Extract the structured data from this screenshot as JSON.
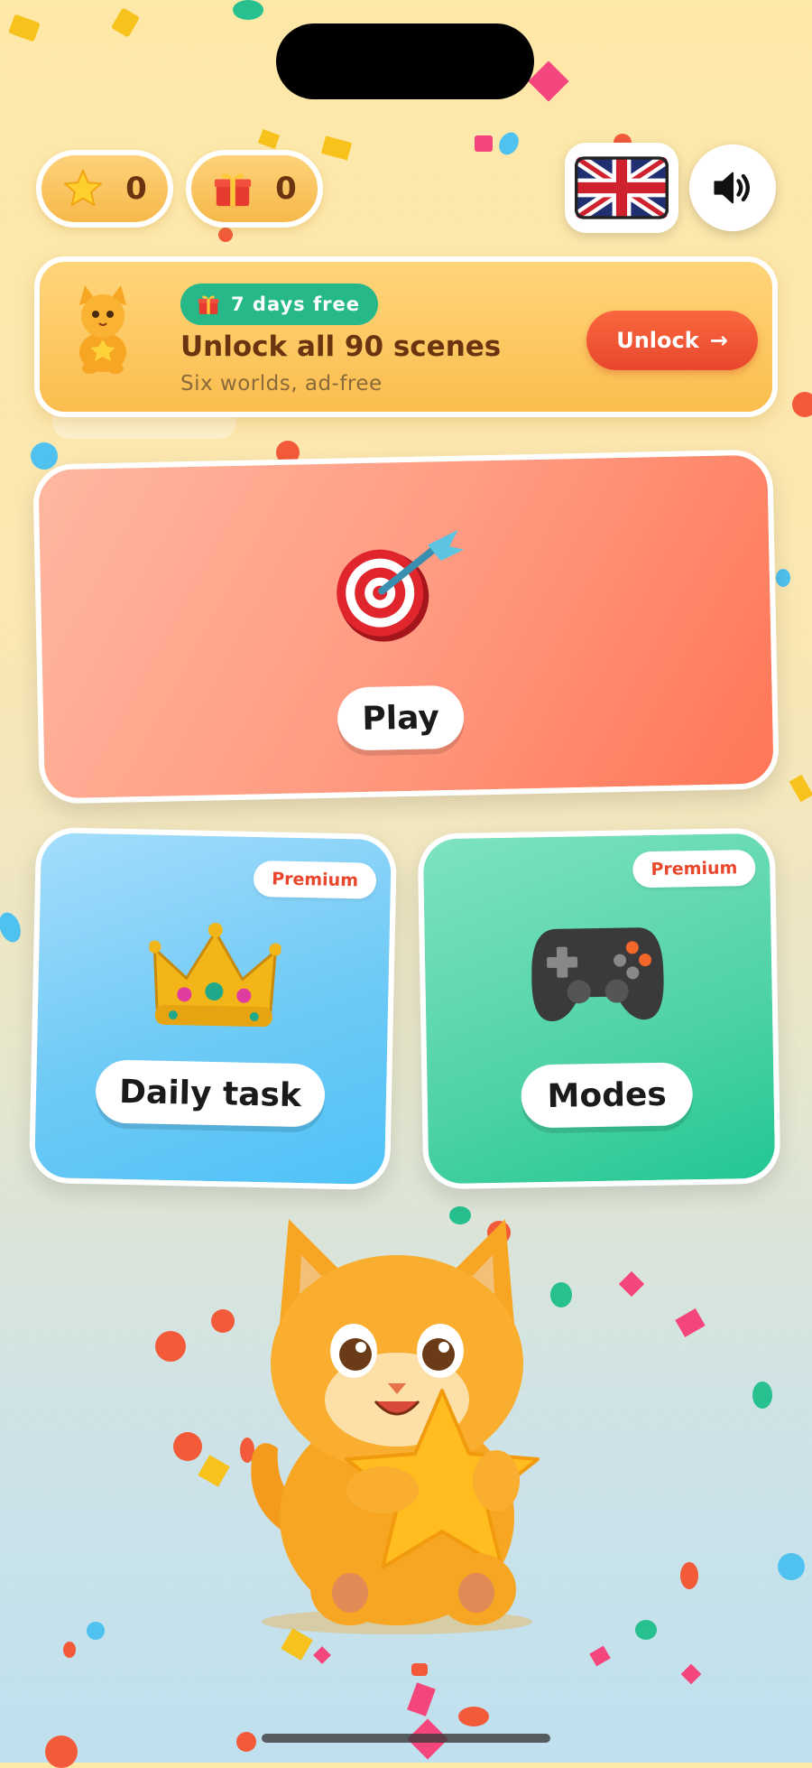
{
  "stats": {
    "stars": {
      "icon": "star-icon",
      "value": "0"
    },
    "gifts": {
      "icon": "gift-icon",
      "value": "0"
    }
  },
  "header": {
    "language_icon": "uk-flag-icon",
    "sound_icon": "speaker-icon"
  },
  "promo": {
    "mascot_icon": "cat-mascot-icon",
    "badge": "7 days free",
    "title": "Unlock all 90 scenes",
    "subtitle": "Six worlds, ad-free",
    "button": "Unlock",
    "button_arrow": "→"
  },
  "menu": {
    "play": {
      "label": "Play",
      "icon": "dart-target-icon"
    },
    "daily": {
      "label": "Daily task",
      "badge": "Premium",
      "icon": "crown-icon"
    },
    "modes": {
      "label": "Modes",
      "badge": "Premium",
      "icon": "gamepad-icon"
    }
  },
  "mascot": {
    "icon": "cat-holding-star-icon"
  },
  "colors": {
    "accent_red": "#e8472c",
    "badge_green": "#27b88a",
    "text_brown": "#6a3410",
    "play_card": "#ff8e70",
    "daily_card": "#6fcaf6",
    "modes_card": "#4fd2a6"
  }
}
